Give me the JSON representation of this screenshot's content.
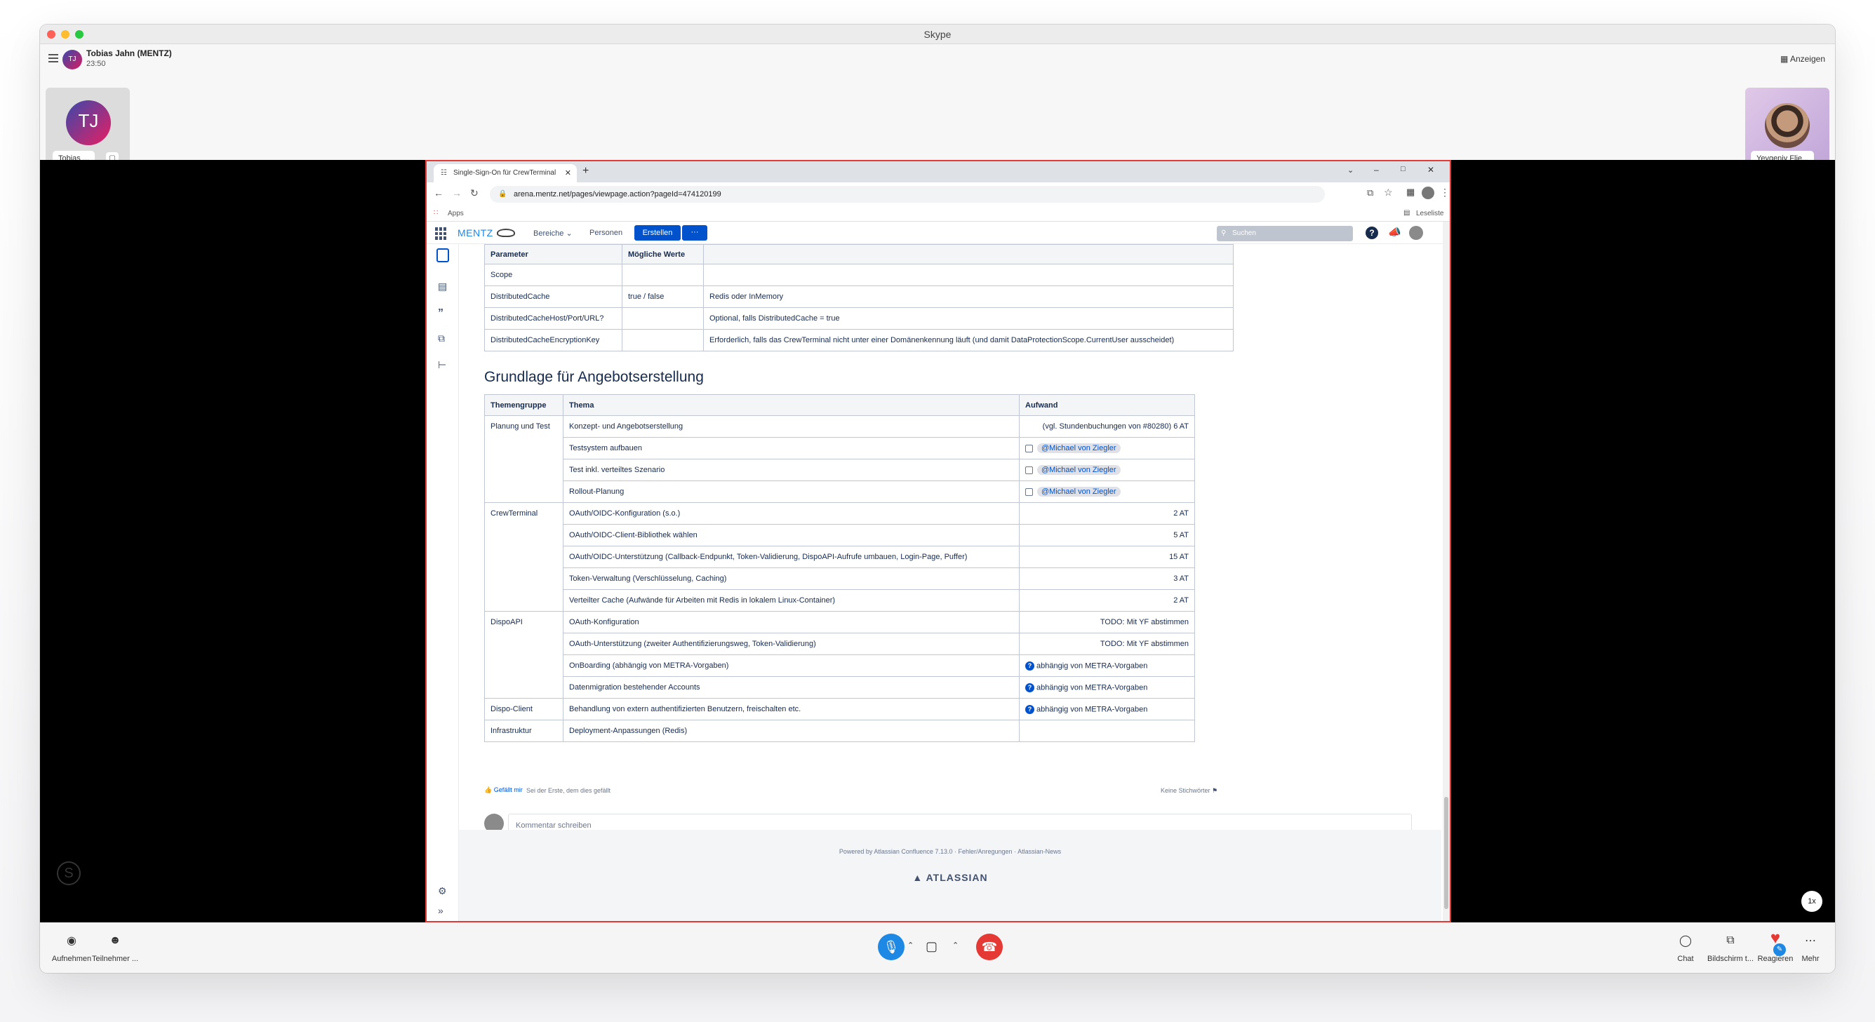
{
  "skype": {
    "window_title": "Skype",
    "caller_name": "Tobias Jahn (MENTZ)",
    "call_time": "23:50",
    "avatar_initials": "TJ",
    "layout_button": "Anzeigen",
    "participants": [
      {
        "initials": "TJ",
        "name": "Tobias ..."
      },
      {
        "name": "Yevgeniy Flie..."
      }
    ],
    "speed_badge": "1x",
    "controls": {
      "record": "Aufnehmen",
      "participants": "Teilnehmer ...",
      "chat": "Chat",
      "share": "Bildschirm t...",
      "react": "Reagieren",
      "more": "Mehr"
    },
    "colors": {
      "hangup": "#e53935",
      "mic": "#1e88e5",
      "share_border": "#e53935"
    }
  },
  "browser": {
    "tab_title": "Single-Sign-On für CrewTerminal",
    "new_tab": "+",
    "url": "arena.mentz.net/pages/viewpage.action?pageId=474120199",
    "bookmarks": {
      "apps": "Apps",
      "reading_list": "Leseliste"
    }
  },
  "confluence": {
    "logo": "MENTZ",
    "nav": {
      "spaces": "Bereiche",
      "people": "Personen",
      "create": "Erstellen",
      "more": "···"
    },
    "search_placeholder": "Suchen",
    "param_table": {
      "headers": [
        "Parameter",
        "Mögliche Werte",
        ""
      ],
      "rows": [
        [
          "Scope",
          "",
          ""
        ],
        [
          "DistributedCache",
          "true / false",
          "Redis oder InMemory"
        ],
        [
          "DistributedCacheHost/Port/URL?",
          "",
          "Optional, falls DistributedCache = true"
        ],
        [
          "DistributedCacheEncryptionKey",
          "",
          "Erforderlich, falls das CrewTerminal nicht unter einer Domänenkennung läuft (und damit DataProtectionScope.CurrentUser ausscheidet)"
        ]
      ]
    },
    "section_heading": "Grundlage für Angebotserstellung",
    "offer_table": {
      "headers": [
        "Themengruppe",
        "Thema",
        "Aufwand"
      ],
      "groups": {
        "planning": "Planung und Test",
        "crewterminal": "CrewTerminal",
        "dispoapi": "DispoAPI",
        "dispoclient": "Dispo-Client",
        "infra": "Infrastruktur"
      },
      "rows": {
        "r1_topic": "Konzept- und Angebotserstellung",
        "r1_effort": "(vgl. Stundenbuchungen von #80280) 6 AT",
        "r2_topic": "Testsystem aufbauen",
        "r3_topic": "Test inkl. verteiltes Szenario",
        "r4_topic": "Rollout-Planung",
        "mention": "@Michael von Ziegler",
        "r5_topic": "OAuth/OIDC-Konfiguration (s.o.)",
        "r5_effort": "2 AT",
        "r6_topic": "OAuth/OIDC-Client-Bibliothek wählen",
        "r6_effort": "5 AT",
        "r7_topic": "OAuth/OIDC-Unterstützung (Callback-Endpunkt, Token-Validierung, DispoAPI-Aufrufe umbauen, Login-Page, Puffer)",
        "r7_effort": "15 AT",
        "r8_topic": "Token-Verwaltung (Verschlüsselung, Caching)",
        "r8_effort": "3 AT",
        "r9_topic": "Verteilter Cache (Aufwände für Arbeiten mit Redis in lokalem Linux-Container)",
        "r9_effort": "2 AT",
        "r10_topic": "OAuth-Konfiguration",
        "r10_effort": "TODO: Mit YF abstimmen",
        "r11_topic": "OAuth-Unterstützung (zweiter Authentifizierungsweg, Token-Validierung)",
        "r11_effort": "TODO: Mit YF abstimmen",
        "r12_topic": "OnBoarding (abhängig von METRA-Vorgaben)",
        "r13_topic": "Datenmigration bestehender Accounts",
        "r14_topic": "Behandlung von extern authentifizierten Benutzern, freischalten etc.",
        "metra": "abhängig von METRA-Vorgaben",
        "r15_topic": "Deployment-Anpassungen (Redis)"
      }
    },
    "like": "Gefällt mir",
    "like_hint": "Sei der Erste, dem dies gefällt",
    "labels": "Keine Stichwörter",
    "comment_placeholder": "Kommentar schreiben",
    "footer": {
      "powered": "Powered by Atlassian Confluence 7.13.0",
      "sep": "·",
      "feedback": "Fehler/Anregungen",
      "news": "Atlassian-News",
      "brand": "ATLASSIAN"
    }
  }
}
